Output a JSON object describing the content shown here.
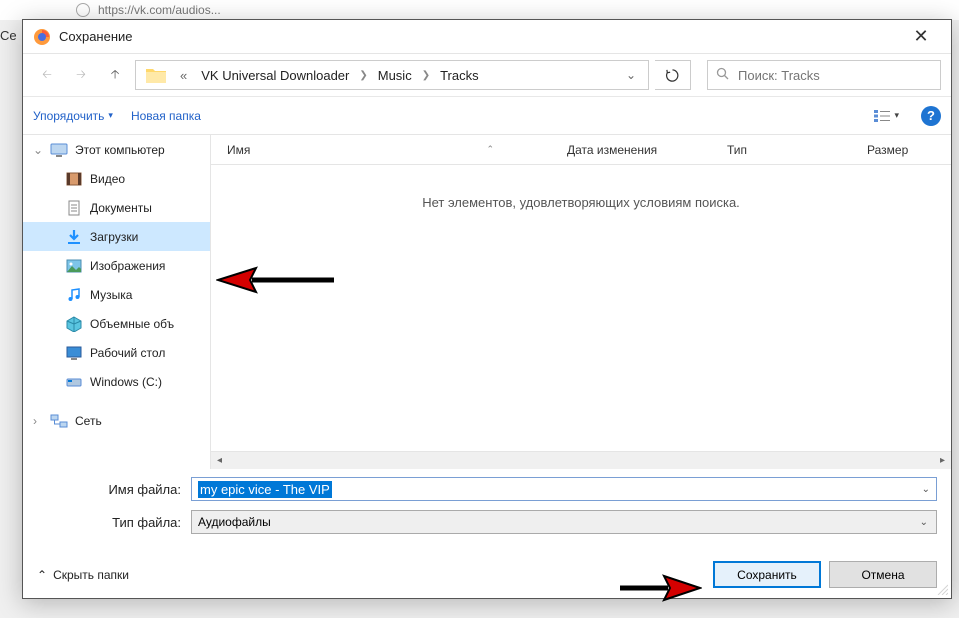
{
  "browser": {
    "url": "https://vk.com/audios..."
  },
  "page_label": "Се",
  "dialog": {
    "title": "Сохранение",
    "breadcrumb": {
      "prefix": "«",
      "seg1": "VK Universal Downloader",
      "seg2": "Music",
      "seg3": "Tracks"
    },
    "search_placeholder": "Поиск: Tracks",
    "toolbar": {
      "organize": "Упорядочить",
      "new_folder": "Новая папка"
    },
    "sidebar": {
      "computer": "Этот компьютер",
      "videos": "Видео",
      "documents": "Документы",
      "downloads": "Загрузки",
      "pictures": "Изображения",
      "music": "Музыка",
      "volumes": "Объемные объ",
      "desktop": "Рабочий стол",
      "drive_c": "Windows (C:)",
      "network": "Сеть"
    },
    "columns": {
      "name": "Имя",
      "date": "Дата изменения",
      "type": "Тип",
      "size": "Размер"
    },
    "empty_msg": "Нет элементов, удовлетворяющих условиям поиска.",
    "filename_label": "Имя файла:",
    "filetype_label": "Тип файла:",
    "filename_value": "my epic vice - The VIP",
    "filetype_value": "Аудиофайлы",
    "hide_folders": "Скрыть папки",
    "save_btn": "Сохранить",
    "cancel_btn": "Отмена"
  }
}
